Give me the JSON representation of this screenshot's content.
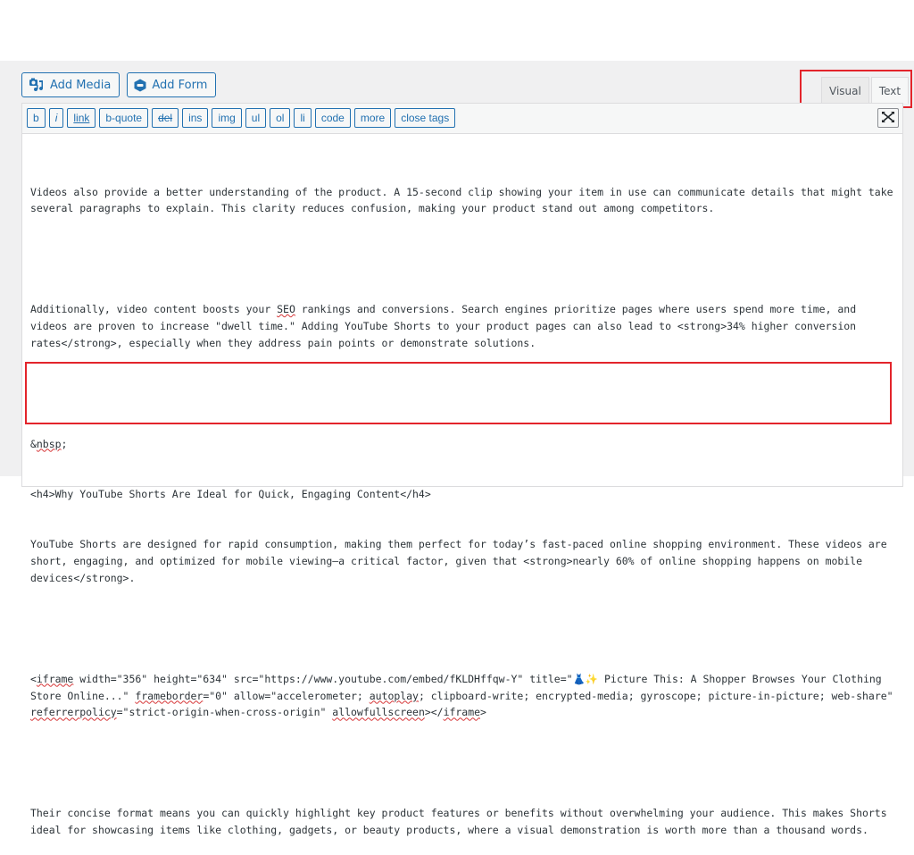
{
  "media_buttons": [
    {
      "label": "Add Media",
      "icon": "media-icon"
    },
    {
      "label": "Add Form",
      "icon": "form-icon"
    }
  ],
  "editor_tabs": [
    {
      "label": "Visual",
      "active": false
    },
    {
      "label": "Text",
      "active": true
    }
  ],
  "quicktags": [
    {
      "label": "b"
    },
    {
      "label": "i"
    },
    {
      "label": "link"
    },
    {
      "label": "b-quote"
    },
    {
      "label": "del"
    },
    {
      "label": "ins"
    },
    {
      "label": "img"
    },
    {
      "label": "ul"
    },
    {
      "label": "ol"
    },
    {
      "label": "li"
    },
    {
      "label": "code"
    },
    {
      "label": "more"
    },
    {
      "label": "close tags"
    }
  ],
  "fullscreen_icon": "fullscreen-expand-icon",
  "content": {
    "p1": "Videos also provide a better understanding of the product. A 15-second clip showing your item in use can communicate details that might take several paragraphs to explain. This clarity reduces confusion, making your product stand out among competitors.",
    "p2_a": "Additionally, video content boosts your ",
    "p2_seo": "SEO",
    "p2_b": " rankings and conversions. Search engines prioritize pages where users spend more time, and videos are proven to increase \"dwell time.\" Adding YouTube Shorts to your product pages can also lead to <strong>34% higher conversion rates</strong>, especially when they address pain points or demonstrate solutions.",
    "nbsp_a": "&",
    "nbsp_b": "nbsp",
    "nbsp_c": ";",
    "h4": "<h4>Why YouTube Shorts Are Ideal for Quick, Engaging Content</h4>",
    "p3": "YouTube Shorts are designed for rapid consumption, making them perfect for today’s fast-paced online shopping environment. These videos are short, engaging, and optimized for mobile viewing—a critical factor, given that <strong>nearly 60% of online shopping happens on mobile devices</strong>.",
    "iframe": {
      "t1": "<",
      "t2": "iframe",
      "t3": " width=\"356\" height=\"634\" src=\"https://www.youtube.com/embed/fKLDHffqw-Y\" title=\"👗✨ Picture This: A Shopper Browses Your Clothing Store Online...\" ",
      "t4": "frameborder",
      "t5": "=\"0\" allow=\"accelerometer; ",
      "t6": "autoplay",
      "t7": "; clipboard-write; encrypted-media; gyroscope; picture-in-picture; web-share\" ",
      "t8": "referrerpolicy",
      "t9": "=\"strict-origin-when-cross-origin\" ",
      "t10": "allowfullscreen",
      "t11": "></",
      "t12": "iframe",
      "t13": ">"
    },
    "p4": "Their concise format means you can quickly highlight key product features or benefits without overwhelming your audience. This makes Shorts ideal for showcasing items like clothing, gadgets, or beauty products, where a visual demonstration is worth more than a thousand words."
  },
  "highlight_color": "#e3242b",
  "accent_color": "#2271b1"
}
